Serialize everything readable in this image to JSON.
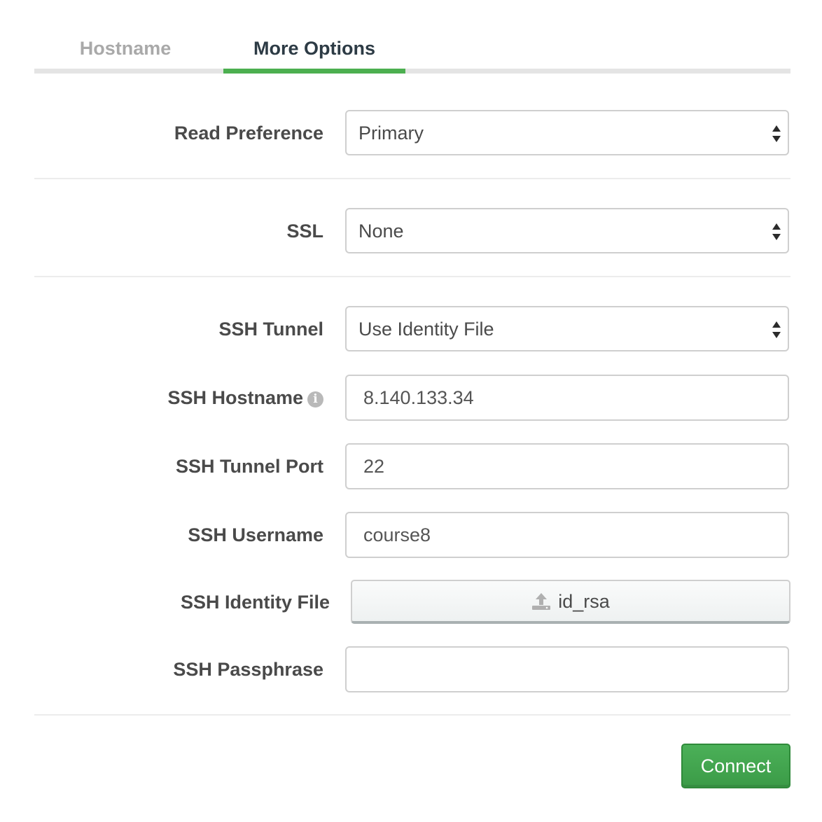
{
  "tabs": [
    {
      "label": "Hostname",
      "active": false
    },
    {
      "label": "More Options",
      "active": true
    }
  ],
  "colors": {
    "active_tab_underline": "#4caf50",
    "connect_button": "#43a64f",
    "inactive_tab_text": "#a9a9a9"
  },
  "form": {
    "read_preference": {
      "label": "Read Preference",
      "value": "Primary"
    },
    "ssl": {
      "label": "SSL",
      "value": "None"
    },
    "ssh_tunnel": {
      "label": "SSH Tunnel",
      "value": "Use Identity File"
    },
    "ssh_hostname": {
      "label": "SSH Hostname",
      "value": "8.140.133.34",
      "info_icon": "info-icon"
    },
    "ssh_tunnel_port": {
      "label": "SSH Tunnel Port",
      "value": "22"
    },
    "ssh_username": {
      "label": "SSH Username",
      "value": "course8"
    },
    "ssh_identity_file": {
      "label": "SSH Identity File",
      "file_name": "id_rsa",
      "icon": "upload-icon"
    },
    "ssh_passphrase": {
      "label": "SSH Passphrase",
      "value": ""
    }
  },
  "actions": {
    "connect_label": "Connect"
  }
}
